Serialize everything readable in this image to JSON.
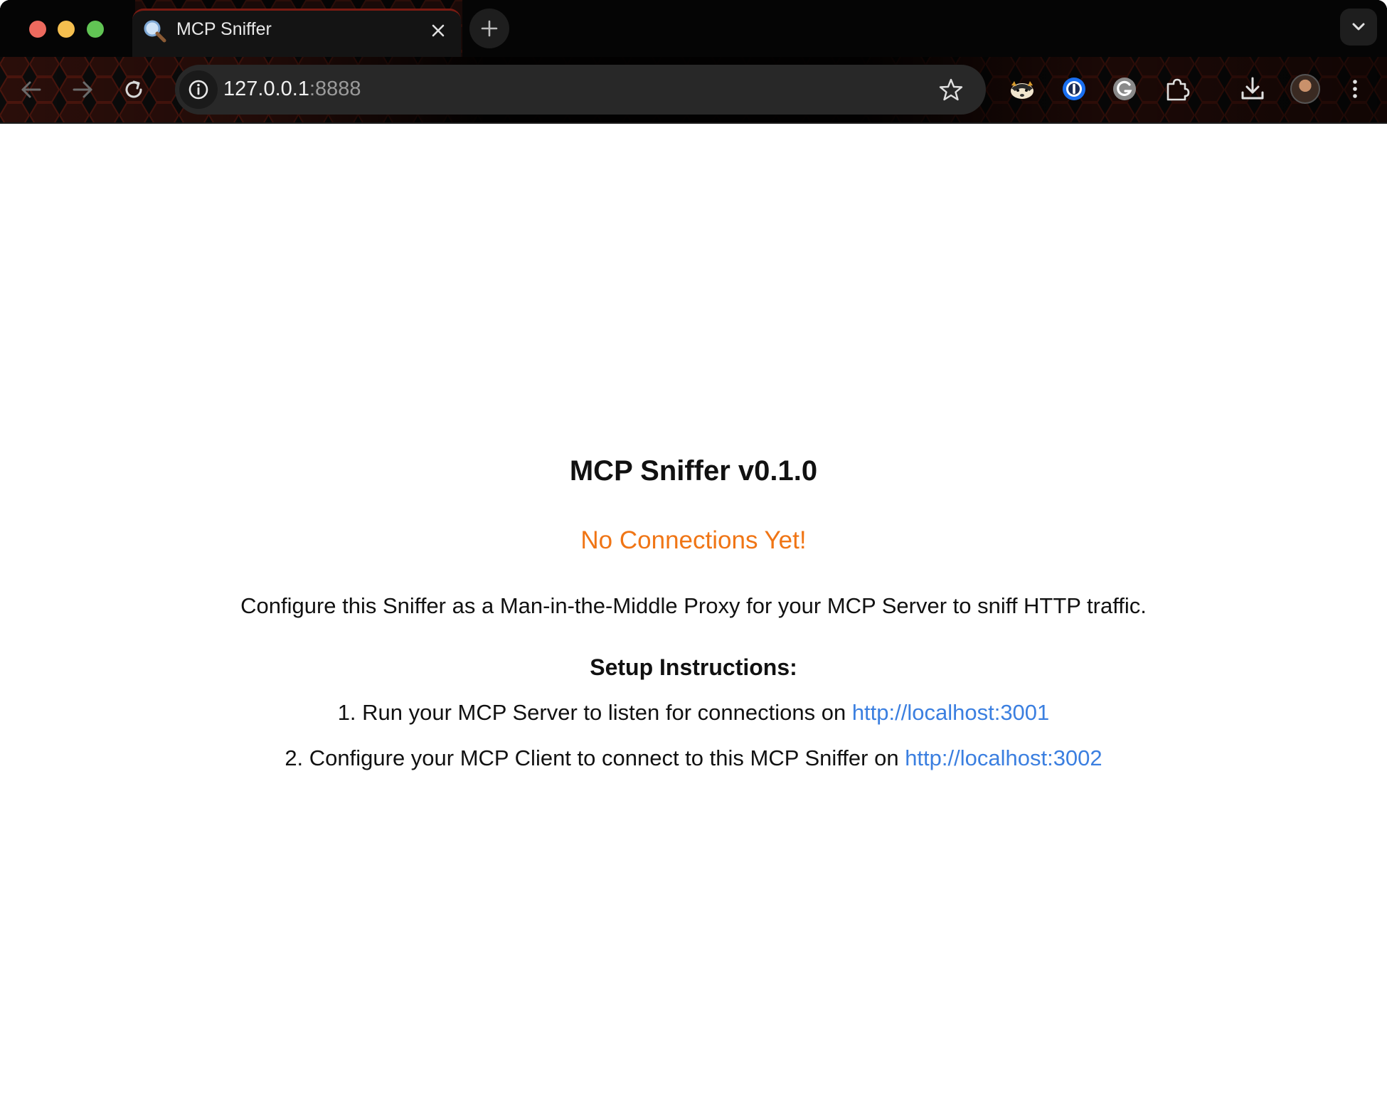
{
  "browser": {
    "tab": {
      "title": "MCP Sniffer",
      "favicon": "magnifier-icon"
    },
    "address": {
      "host": "127.0.0.1",
      "port": ":8888"
    },
    "theme_colors": {
      "frame": "#0b0b0b",
      "hex_accent": "#5a1a10"
    },
    "extensions": [
      "badger-icon",
      "password-manager-icon",
      "grammar-icon",
      "extensions-puzzle-icon"
    ]
  },
  "page": {
    "title": "MCP Sniffer v0.1.0",
    "status": "No Connections Yet!",
    "description": "Configure this Sniffer as a Man-in-the-Middle Proxy for your MCP Server to sniff HTTP traffic.",
    "setup_heading": "Setup Instructions:",
    "steps": [
      {
        "text": "1. Run your MCP Server to listen for connections on ",
        "link": "http://localhost:3001"
      },
      {
        "text": "2. Configure your MCP Client to connect to this MCP Sniffer on ",
        "link": "http://localhost:3002"
      }
    ],
    "colors": {
      "status": "#f07515",
      "link": "#3b7fe0"
    }
  }
}
